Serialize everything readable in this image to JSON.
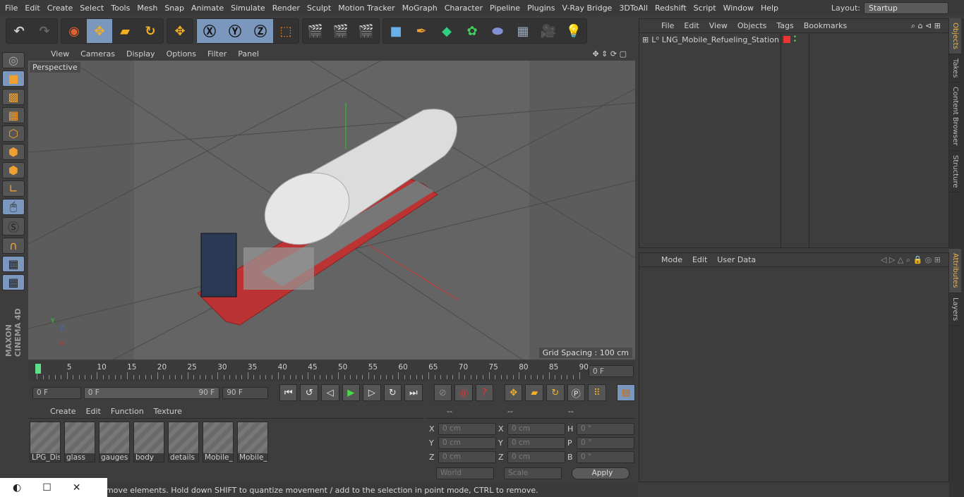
{
  "menu": [
    "File",
    "Edit",
    "Create",
    "Select",
    "Tools",
    "Mesh",
    "Snap",
    "Animate",
    "Simulate",
    "Render",
    "Sculpt",
    "Motion Tracker",
    "MoGraph",
    "Character",
    "Pipeline",
    "Plugins",
    "V-Ray Bridge",
    "3DToAll",
    "Redshift",
    "Script",
    "Window",
    "Help"
  ],
  "layout": {
    "label": "Layout:",
    "value": "Startup"
  },
  "viewport": {
    "menu": [
      "View",
      "Cameras",
      "Display",
      "Options",
      "Filter",
      "Panel"
    ],
    "label": "Perspective",
    "grid": "Grid Spacing : 100 cm"
  },
  "timeline": {
    "ticks": [
      "0",
      "5",
      "10",
      "15",
      "20",
      "25",
      "30",
      "35",
      "40",
      "45",
      "50",
      "55",
      "60",
      "65",
      "70",
      "75",
      "80",
      "85",
      "90"
    ],
    "frame": "0 F"
  },
  "controls": {
    "start": "0 F",
    "range_start": "0 F",
    "range_end": "90 F",
    "end": "90 F"
  },
  "materials": {
    "menu": [
      "Create",
      "Edit",
      "Function",
      "Texture"
    ],
    "items": [
      "LPG_Dis",
      "glass",
      "gauges",
      "body",
      "details",
      "Mobile_",
      "Mobile_"
    ]
  },
  "coords": {
    "head": [
      "--",
      "--",
      "--"
    ],
    "rows": [
      [
        "X",
        "0 cm",
        "X",
        "0 cm",
        "H",
        "0 °"
      ],
      [
        "Y",
        "0 cm",
        "Y",
        "0 cm",
        "P",
        "0 °"
      ],
      [
        "Z",
        "0 cm",
        "Z",
        "0 cm",
        "B",
        "0 °"
      ]
    ],
    "world": "World",
    "scale": "Scale",
    "apply": "Apply"
  },
  "status": "move elements. Hold down SHIFT to quantize movement / add to the selection in point mode, CTRL to remove.",
  "objects": {
    "menu": [
      "File",
      "Edit",
      "View",
      "Objects",
      "Tags",
      "Bookmarks"
    ],
    "item": "LNG_Mobile_Refueling_Station"
  },
  "attributes": {
    "menu": [
      "Mode",
      "Edit",
      "User Data"
    ]
  },
  "tabs": [
    "Objects",
    "Takes",
    "Content Browser",
    "Structure",
    "Attributes",
    "Layers"
  ],
  "logo": "MAXON CINEMA 4D"
}
